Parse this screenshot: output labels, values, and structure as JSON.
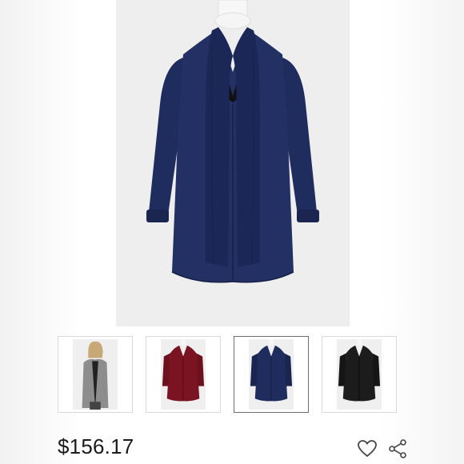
{
  "product": {
    "price": "$156.17",
    "colors": {
      "main": "#1e2b5c",
      "selected_thumb_border": "#6e6e6e"
    }
  },
  "thumbnails": [
    {
      "variant": "grey",
      "color": "#8d8d8d",
      "icon": "model-photo"
    },
    {
      "variant": "burgundy",
      "color": "#7a1422",
      "icon": "cardigan"
    },
    {
      "variant": "navy",
      "color": "#1e2b5c",
      "icon": "cardigan",
      "selected": true
    },
    {
      "variant": "black",
      "color": "#1c1c1c",
      "icon": "cardigan"
    }
  ],
  "actions": {
    "like_icon": "heart-icon",
    "share_icon": "share-icon"
  }
}
